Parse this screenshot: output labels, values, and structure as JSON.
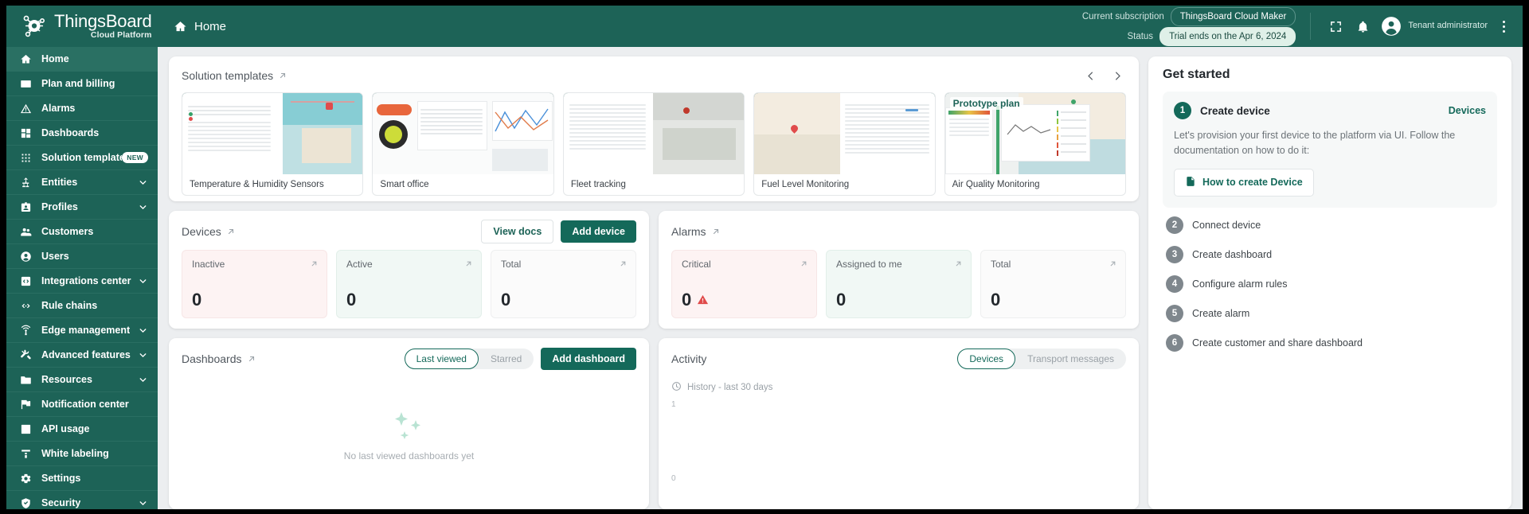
{
  "header": {
    "logo_title": "ThingsBoard",
    "logo_subtitle": "Cloud Platform",
    "breadcrumb": "Home",
    "subscription_label": "Current subscription",
    "subscription_value": "ThingsBoard Cloud Maker",
    "status_label": "Status",
    "status_value": "Trial ends on the Apr 6, 2024",
    "user_role": "Tenant administrator"
  },
  "sidebar": {
    "items": [
      {
        "label": "Home",
        "icon": "home-icon",
        "active": true,
        "badge": "",
        "chevron": false
      },
      {
        "label": "Plan and billing",
        "icon": "card-icon",
        "active": false,
        "badge": "",
        "chevron": false
      },
      {
        "label": "Alarms",
        "icon": "alarm-triangle-icon",
        "active": false,
        "badge": "",
        "chevron": false
      },
      {
        "label": "Dashboards",
        "icon": "dashboards-icon",
        "active": false,
        "badge": "",
        "chevron": false
      },
      {
        "label": "Solution templates",
        "icon": "grid-dots-icon",
        "active": false,
        "badge": "NEW",
        "chevron": false
      },
      {
        "label": "Entities",
        "icon": "entities-icon",
        "active": false,
        "badge": "",
        "chevron": true
      },
      {
        "label": "Profiles",
        "icon": "profiles-icon",
        "active": false,
        "badge": "",
        "chevron": true
      },
      {
        "label": "Customers",
        "icon": "customers-icon",
        "active": false,
        "badge": "",
        "chevron": false
      },
      {
        "label": "Users",
        "icon": "user-icon",
        "active": false,
        "badge": "",
        "chevron": false
      },
      {
        "label": "Integrations center",
        "icon": "integrations-icon",
        "active": false,
        "badge": "",
        "chevron": true
      },
      {
        "label": "Rule chains",
        "icon": "rule-chains-icon",
        "active": false,
        "badge": "",
        "chevron": false
      },
      {
        "label": "Edge management",
        "icon": "edge-icon",
        "active": false,
        "badge": "",
        "chevron": true
      },
      {
        "label": "Advanced features",
        "icon": "tools-icon",
        "active": false,
        "badge": "",
        "chevron": true
      },
      {
        "label": "Resources",
        "icon": "folder-icon",
        "active": false,
        "badge": "",
        "chevron": true
      },
      {
        "label": "Notification center",
        "icon": "notification-flag-icon",
        "active": false,
        "badge": "",
        "chevron": false
      },
      {
        "label": "API usage",
        "icon": "bar-chart-icon",
        "active": false,
        "badge": "",
        "chevron": false
      },
      {
        "label": "White labeling",
        "icon": "white-label-icon",
        "active": false,
        "badge": "",
        "chevron": false
      },
      {
        "label": "Settings",
        "icon": "gear-icon",
        "active": false,
        "badge": "",
        "chevron": false
      },
      {
        "label": "Security",
        "icon": "shield-icon",
        "active": false,
        "badge": "",
        "chevron": true
      }
    ]
  },
  "solution_templates": {
    "title": "Solution templates",
    "items": [
      {
        "name": "Temperature & Humidity Sensors",
        "thumb": "table-map"
      },
      {
        "name": "Smart office",
        "thumb": "gauge-chart"
      },
      {
        "name": "Fleet tracking",
        "thumb": "table-satellite"
      },
      {
        "name": "Fuel Level Monitoring",
        "thumb": "map-table"
      },
      {
        "name": "Air Quality Monitoring",
        "thumb": "proto-map",
        "tag": "Prototype plan"
      }
    ]
  },
  "devices": {
    "title": "Devices",
    "view_docs_label": "View docs",
    "add_device_label": "Add device",
    "stats": [
      {
        "label": "Inactive",
        "value": "0",
        "tone": "red"
      },
      {
        "label": "Active",
        "value": "0",
        "tone": "green"
      },
      {
        "label": "Total",
        "value": "0",
        "tone": "plain"
      }
    ]
  },
  "alarms": {
    "title": "Alarms",
    "stats": [
      {
        "label": "Critical",
        "value": "0",
        "tone": "red",
        "warn": true
      },
      {
        "label": "Assigned to me",
        "value": "0",
        "tone": "green",
        "warn": false
      },
      {
        "label": "Total",
        "value": "0",
        "tone": "plain",
        "warn": false
      }
    ]
  },
  "dashboards": {
    "title": "Dashboards",
    "toggle_last_viewed": "Last viewed",
    "toggle_starred": "Starred",
    "add_dashboard_label": "Add dashboard",
    "empty_text": "No last viewed dashboards yet"
  },
  "activity": {
    "title": "Activity",
    "toggle_devices": "Devices",
    "toggle_transport": "Transport messages",
    "history_label": "History - last 30 days",
    "y_top": "1",
    "y_bottom": "0"
  },
  "get_started": {
    "title": "Get started",
    "step1": {
      "number": "1",
      "name": "Create device",
      "link": "Devices",
      "description": "Let's provision your first device to the platform via UI. Follow the documentation on how to do it:",
      "doc_button": "How to create Device"
    },
    "steps": [
      {
        "number": "2",
        "name": "Connect device"
      },
      {
        "number": "3",
        "name": "Create dashboard"
      },
      {
        "number": "4",
        "name": "Configure alarm rules"
      },
      {
        "number": "5",
        "name": "Create alarm"
      },
      {
        "number": "6",
        "name": "Create customer and share dashboard"
      }
    ]
  },
  "colors": {
    "brand_teal": "#1d6357",
    "primary_button": "#14695a",
    "accent_link": "#14695a",
    "page_bg": "#eceef0",
    "critical_red": "#e04b4b"
  }
}
